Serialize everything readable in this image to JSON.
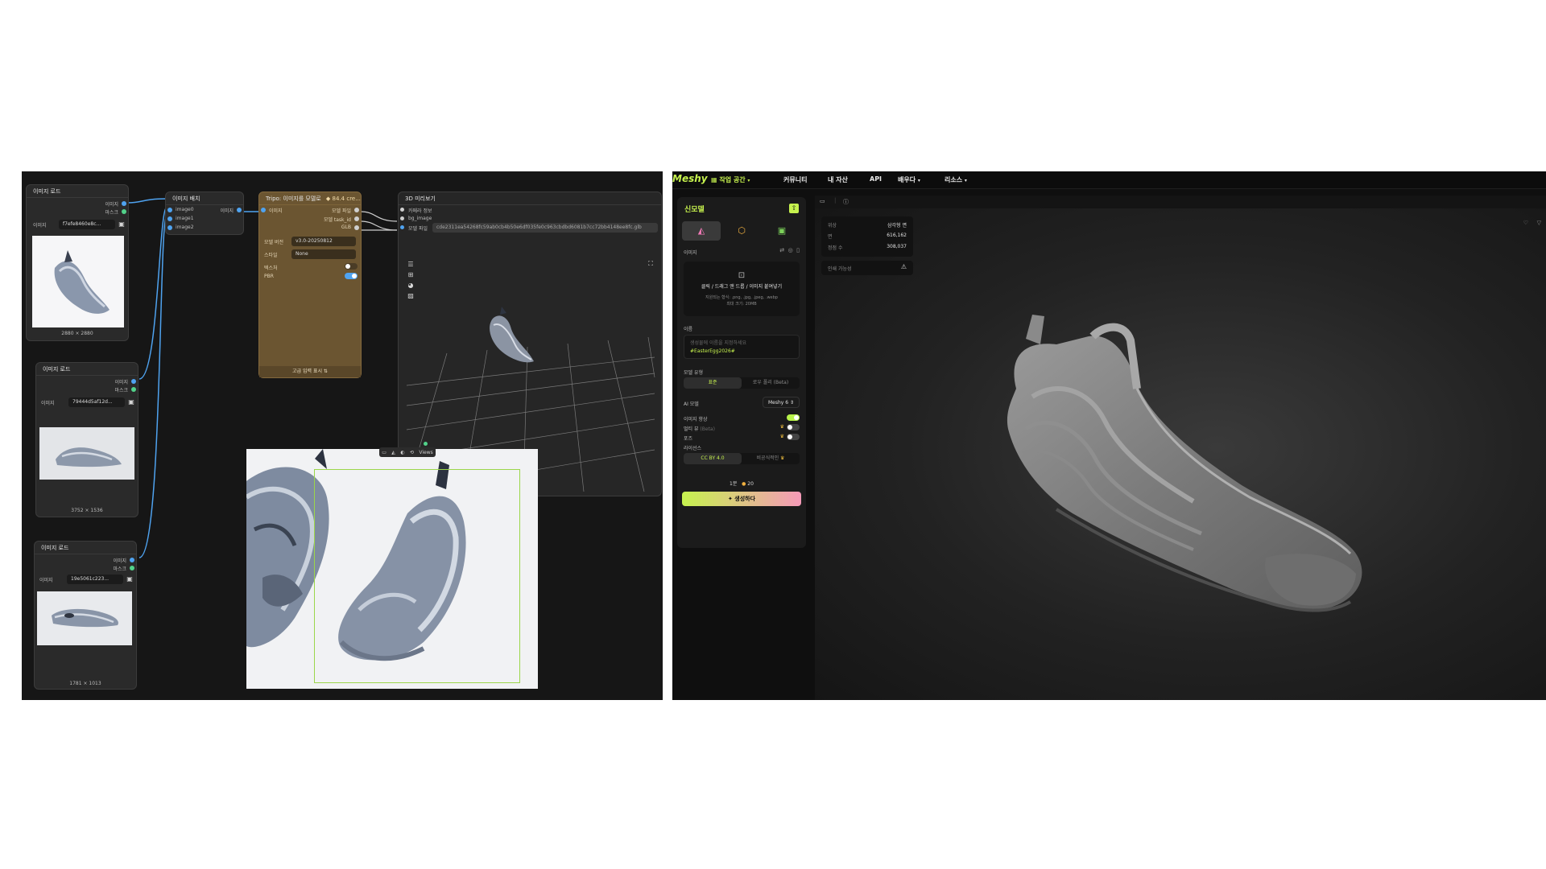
{
  "left_panel": {
    "nodes": {
      "load1": {
        "title": "이미지 로드",
        "out1": "이미지",
        "out2": "마스크",
        "field_label": "이미지",
        "filename": "f7efe8460e8c...",
        "dims": "2880 × 2880"
      },
      "load2": {
        "title": "이미지 로드",
        "out1": "이미지",
        "out2": "마스크",
        "field_label": "이미지",
        "filename": "79444d5af12d...",
        "dims": "3752 × 1536"
      },
      "load3": {
        "title": "이미지 로드",
        "out1": "이미지",
        "out2": "마스크",
        "field_label": "이미지",
        "filename": "19e5061c223...",
        "dims": "1781 × 1013"
      },
      "batch": {
        "title": "이미지 배치",
        "in0": "image0",
        "in1": "image1",
        "in2": "image2",
        "out": "이미지"
      },
      "tripo": {
        "title": "Tripo: 이미지를 모델로",
        "credits": "84.4 cre...",
        "in_image": "이미지",
        "out_path": "모델 파일",
        "out_task": "모델 task_id",
        "out_glb": "GLB",
        "version_label": "모델 버전",
        "version_value": "v3.0-20250812",
        "style_label": "스타일",
        "style_value": "None",
        "texture_label": "텍스처",
        "pbr_label": "PBR",
        "footer": "고급 입력 표시"
      },
      "viewer": {
        "title": "3D 미리보기",
        "in_camera": "카메라 정보",
        "in_bg": "bg_image",
        "in_model": "모델 파일",
        "path_value": "cde2311ea54268fc59ab0cb4b50e6df035fe0c963cbdbd6081b7cc72bb4148ee8fc.glb"
      }
    },
    "preview_toolbar": [
      "▭",
      "◭",
      "◐",
      "⟲",
      "Views"
    ]
  },
  "right_panel": {
    "brand": "Meshy",
    "nav": {
      "workspace": "작업 공간",
      "community": "커뮤니티",
      "assets": "내 자산",
      "api": "API",
      "learn": "배우다",
      "resources": "리소스"
    },
    "sidebar": {
      "title": "신모델",
      "image_section": "이미지",
      "upload_main": "클릭 / 드래그 앤 드롭 / 이미지 붙여넣기",
      "upload_formats": "지원되는 형식: .png, .jpg, .jpeg, .webp",
      "upload_max": "최대 크기: 20MB",
      "name_label": "이름",
      "name_placeholder": "생성물에 이름을 지정하세요",
      "name_tag": "#EasterEgg2026#",
      "model_type_label": "모델 유형",
      "model_type_standard": "표준",
      "model_type_lowpoly": "로우 폴리 (Beta)",
      "ai_model_label": "AI 모델",
      "ai_model_value": "Meshy 6",
      "enhance_label": "이미지 향상",
      "multiview_label": "멀티 뷰",
      "multiview_beta": "(Beta)",
      "pose_label": "포즈",
      "license_label": "라이선스",
      "license_cc": "CC BY 4.0",
      "license_private": "비공식적인",
      "count": "1분",
      "credits": "20",
      "generate": "생성하다"
    },
    "stats": {
      "topology_label": "위상",
      "topology_value": "삼각형 면",
      "faces_label": "면",
      "faces_value": "616,162",
      "verts_label": "정점 수",
      "verts_value": "308,037",
      "print_label": "인쇄 가능성"
    }
  }
}
